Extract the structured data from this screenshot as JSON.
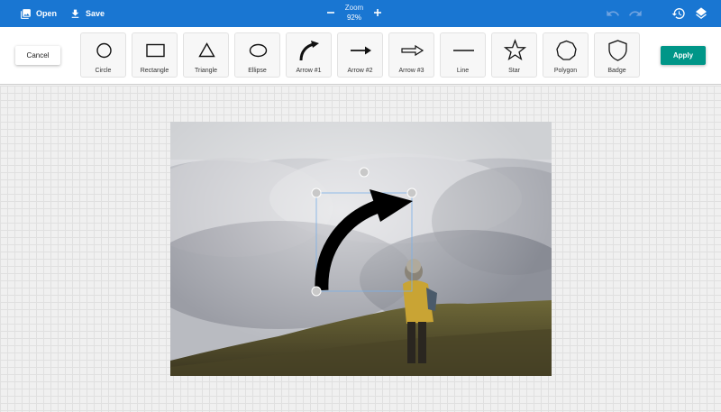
{
  "header": {
    "open_label": "Open",
    "save_label": "Save",
    "zoom_label": "Zoom",
    "zoom_value": "92%"
  },
  "toolbar": {
    "cancel_label": "Cancel",
    "apply_label": "Apply",
    "shapes": [
      {
        "label": "Circle",
        "icon": "circle-icon"
      },
      {
        "label": "Rectangle",
        "icon": "rectangle-icon"
      },
      {
        "label": "Triangle",
        "icon": "triangle-icon"
      },
      {
        "label": "Ellipse",
        "icon": "ellipse-icon"
      },
      {
        "label": "Arrow #1",
        "icon": "curved-arrow-icon"
      },
      {
        "label": "Arrow #2",
        "icon": "arrow-icon"
      },
      {
        "label": "Arrow #3",
        "icon": "hollow-arrow-icon"
      },
      {
        "label": "Line",
        "icon": "line-icon"
      },
      {
        "label": "Star",
        "icon": "star-icon"
      },
      {
        "label": "Polygon",
        "icon": "polygon-icon"
      },
      {
        "label": "Badge",
        "icon": "badge-icon"
      }
    ]
  },
  "colors": {
    "header_bg": "#1976d2",
    "apply_bg": "#009688",
    "handle": "#c8c8c8"
  }
}
